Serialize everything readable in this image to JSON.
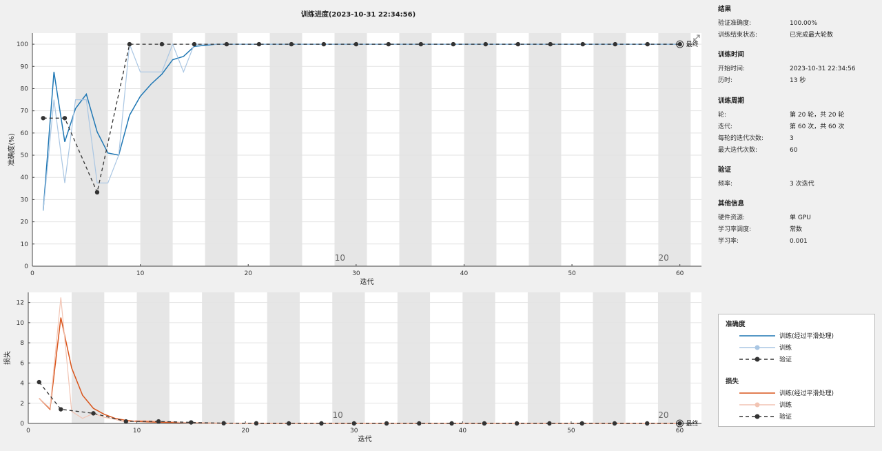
{
  "chart_data": [
    {
      "type": "line",
      "title": "训练进度(2023-10-31 22:34:56)",
      "xlabel": "迭代",
      "ylabel": "准确度(%)",
      "xlim": [
        0,
        62
      ],
      "ylim": [
        0,
        105
      ],
      "xticks": [
        0,
        10,
        20,
        30,
        40,
        50,
        60
      ],
      "yticks": [
        0,
        10,
        20,
        30,
        40,
        50,
        60,
        70,
        80,
        90,
        100
      ],
      "epoch_bands": [
        4,
        7,
        10,
        13,
        16,
        19,
        22,
        25,
        28,
        31,
        34,
        37,
        40,
        43,
        46,
        49,
        52,
        55,
        58,
        61
      ],
      "epoch_labels": [
        {
          "x": 28.5,
          "text": "10"
        },
        {
          "x": 58.5,
          "text": "20"
        }
      ],
      "final_label": "最终",
      "grid": true,
      "series": [
        {
          "name": "训练(经过平滑处理)",
          "color": "#1f77b4",
          "style": "solid",
          "x": [
            1,
            2,
            3,
            4,
            5,
            6,
            7,
            8,
            9,
            10,
            11,
            12,
            13,
            14,
            15,
            16,
            17,
            18,
            19,
            20,
            21,
            22,
            23,
            24,
            25,
            26,
            27,
            28,
            29,
            30,
            31,
            32,
            33,
            34,
            35,
            36,
            37,
            38,
            39,
            40,
            41,
            42,
            43,
            44,
            45,
            46,
            47,
            48,
            49,
            50,
            51,
            52,
            53,
            54,
            55,
            56,
            57,
            58,
            59,
            60
          ],
          "y": [
            25,
            87.5,
            56,
            71,
            77.5,
            60.5,
            51,
            50,
            68,
            76.5,
            82,
            86.5,
            93,
            94.5,
            99,
            99.5,
            100,
            100,
            100,
            100,
            100,
            100,
            100,
            100,
            100,
            100,
            100,
            100,
            100,
            100,
            100,
            100,
            100,
            100,
            100,
            100,
            100,
            100,
            100,
            100,
            100,
            100,
            100,
            100,
            100,
            100,
            100,
            100,
            100,
            100,
            100,
            100,
            100,
            100,
            100,
            100,
            100,
            100,
            100,
            100
          ]
        },
        {
          "name": "训练",
          "color": "#a9c6e3",
          "style": "solid",
          "x": [
            1,
            2,
            3,
            4,
            5,
            6,
            7,
            8,
            9,
            10,
            11,
            12,
            13,
            14,
            15,
            16,
            17,
            18,
            19,
            20,
            21,
            22,
            23,
            24,
            25,
            26,
            27,
            28,
            29,
            30,
            31,
            32,
            33,
            34,
            35,
            36,
            37,
            38,
            39,
            40,
            41,
            42,
            43,
            44,
            45,
            46,
            47,
            48,
            49,
            50,
            51,
            52,
            53,
            54,
            55,
            56,
            57,
            58,
            59,
            60
          ],
          "y": [
            25,
            75,
            37.5,
            75,
            75,
            37.5,
            37.5,
            50,
            100,
            87.5,
            87.5,
            87.5,
            100,
            87.5,
            100,
            100,
            100,
            100,
            100,
            100,
            100,
            100,
            100,
            100,
            100,
            100,
            100,
            100,
            100,
            100,
            100,
            100,
            100,
            100,
            100,
            100,
            100,
            100,
            100,
            100,
            100,
            100,
            100,
            100,
            100,
            100,
            100,
            100,
            100,
            100,
            100,
            100,
            100,
            100,
            100,
            100,
            100,
            100,
            100,
            100
          ]
        },
        {
          "name": "验证",
          "color": "#333333",
          "style": "dashed-marker",
          "x": [
            1,
            3,
            6,
            9,
            12,
            15,
            18,
            21,
            24,
            27,
            30,
            33,
            36,
            39,
            42,
            45,
            48,
            51,
            54,
            57,
            60
          ],
          "y": [
            66.7,
            66.7,
            33.3,
            100,
            100,
            100,
            100,
            100,
            100,
            100,
            100,
            100,
            100,
            100,
            100,
            100,
            100,
            100,
            100,
            100,
            100
          ]
        }
      ]
    },
    {
      "type": "line",
      "xlabel": "迭代",
      "ylabel": "损失",
      "xlim": [
        0,
        62
      ],
      "ylim": [
        0,
        13
      ],
      "xticks": [
        0,
        10,
        20,
        30,
        40,
        50,
        60
      ],
      "yticks": [
        0,
        2,
        4,
        6,
        8,
        10,
        12
      ],
      "epoch_bands": [
        4,
        7,
        10,
        13,
        16,
        19,
        22,
        25,
        28,
        31,
        34,
        37,
        40,
        43,
        46,
        49,
        52,
        55,
        58,
        61
      ],
      "epoch_labels": [
        {
          "x": 28.5,
          "text": "10"
        },
        {
          "x": 58.5,
          "text": "20"
        }
      ],
      "final_label": "最终",
      "grid": true,
      "series": [
        {
          "name": "训练(经过平滑处理)",
          "color": "#d9541a",
          "style": "solid",
          "x": [
            1,
            2,
            3,
            4,
            5,
            6,
            7,
            8,
            9,
            10,
            11,
            12,
            13,
            14,
            15,
            16,
            17,
            18,
            19,
            20,
            21,
            22,
            23,
            24,
            25,
            26,
            27,
            28,
            29,
            30,
            31,
            32,
            33,
            34,
            35,
            36,
            37,
            38,
            39,
            40,
            41,
            42,
            43,
            44,
            45,
            46,
            47,
            48,
            49,
            50,
            51,
            52,
            53,
            54,
            55,
            56,
            57,
            58,
            59,
            60
          ],
          "y": [
            2.5,
            1.4,
            10.5,
            5.5,
            2.8,
            1.5,
            0.9,
            0.5,
            0.3,
            0.2,
            0.15,
            0.12,
            0.1,
            0.08,
            0.06,
            0.04,
            0.03,
            0.02,
            0.01,
            0.01,
            0.01,
            0,
            0,
            0,
            0,
            0,
            0,
            0,
            0,
            0,
            0,
            0,
            0,
            0,
            0,
            0,
            0,
            0,
            0,
            0,
            0,
            0,
            0,
            0,
            0,
            0,
            0,
            0,
            0,
            0,
            0,
            0,
            0,
            0,
            0,
            0,
            0,
            0,
            0,
            0
          ]
        },
        {
          "name": "训练",
          "color": "#f2c4b3",
          "style": "solid",
          "x": [
            1,
            2,
            3,
            4,
            5,
            6,
            7,
            8,
            9,
            10,
            11,
            12,
            13,
            14,
            15,
            16,
            17,
            18,
            19,
            20,
            21,
            22,
            23,
            24,
            25,
            26,
            27,
            28,
            29,
            30,
            31,
            32,
            33,
            34,
            35,
            36,
            37,
            38,
            39,
            40,
            41,
            42,
            43,
            44,
            45,
            46,
            47,
            48,
            49,
            50,
            51,
            52,
            53,
            54,
            55,
            56,
            57,
            58,
            59,
            60
          ],
          "y": [
            2.5,
            1.5,
            12.5,
            1.2,
            0.5,
            1.0,
            0.6,
            0.4,
            0.1,
            0.3,
            0.3,
            0.2,
            0.2,
            0.1,
            0.05,
            0.05,
            0.02,
            0.02,
            0.01,
            0.01,
            0.01,
            0,
            0,
            0,
            0,
            0,
            0,
            0,
            0,
            0,
            0,
            0,
            0,
            0,
            0,
            0,
            0,
            0,
            0,
            0,
            0,
            0,
            0,
            0,
            0,
            0,
            0,
            0,
            0,
            0,
            0,
            0,
            0,
            0,
            0,
            0,
            0,
            0,
            0,
            0
          ]
        },
        {
          "name": "验证",
          "color": "#333333",
          "style": "dashed-marker",
          "x": [
            1,
            3,
            6,
            9,
            12,
            15,
            18,
            21,
            24,
            27,
            30,
            33,
            36,
            39,
            42,
            45,
            48,
            51,
            54,
            57,
            60
          ],
          "y": [
            4.1,
            1.4,
            1.0,
            0.2,
            0.2,
            0.1,
            0.02,
            0.01,
            0,
            0,
            0,
            0,
            0,
            0,
            0,
            0,
            0,
            0,
            0,
            0,
            0
          ]
        }
      ]
    }
  ],
  "side_panel": {
    "sections": [
      {
        "title": "结果",
        "rows": [
          {
            "k": "验证准确度:",
            "v": "100.00%"
          },
          {
            "k": "训练结束状态:",
            "v": "已完成最大轮数"
          }
        ]
      },
      {
        "title": "训练时间",
        "rows": [
          {
            "k": "开始时间:",
            "v": "2023-10-31 22:34:56"
          },
          {
            "k": "历时:",
            "v": "13 秒"
          }
        ]
      },
      {
        "title": "训练周期",
        "rows": [
          {
            "k": "轮:",
            "v": "第 20 轮，共 20 轮"
          },
          {
            "k": "迭代:",
            "v": "第 60 次，共 60 次"
          },
          {
            "k": "每轮的迭代次数:",
            "v": "3"
          },
          {
            "k": "最大迭代次数:",
            "v": "60"
          }
        ]
      },
      {
        "title": "验证",
        "rows": [
          {
            "k": "频率:",
            "v": "3 次迭代"
          }
        ]
      },
      {
        "title": "其他信息",
        "rows": [
          {
            "k": "硬件资源:",
            "v": "单 GPU"
          },
          {
            "k": "学习率调度:",
            "v": "常数"
          },
          {
            "k": "学习率:",
            "v": "0.001"
          }
        ]
      }
    ]
  },
  "legend": {
    "groups": [
      {
        "title": "准确度",
        "items": [
          {
            "label": "训练(经过平滑处理)",
            "color": "#1f77b4",
            "style": "solid"
          },
          {
            "label": "训练",
            "color": "#a9c6e3",
            "style": "solid-marker"
          },
          {
            "label": "验证",
            "color": "#333333",
            "style": "dashed-marker"
          }
        ]
      },
      {
        "title": "损失",
        "items": [
          {
            "label": "训练(经过平滑处理)",
            "color": "#d9541a",
            "style": "solid"
          },
          {
            "label": "训练",
            "color": "#f2c4b3",
            "style": "solid-marker"
          },
          {
            "label": "验证",
            "color": "#333333",
            "style": "dashed-marker"
          }
        ]
      }
    ]
  }
}
